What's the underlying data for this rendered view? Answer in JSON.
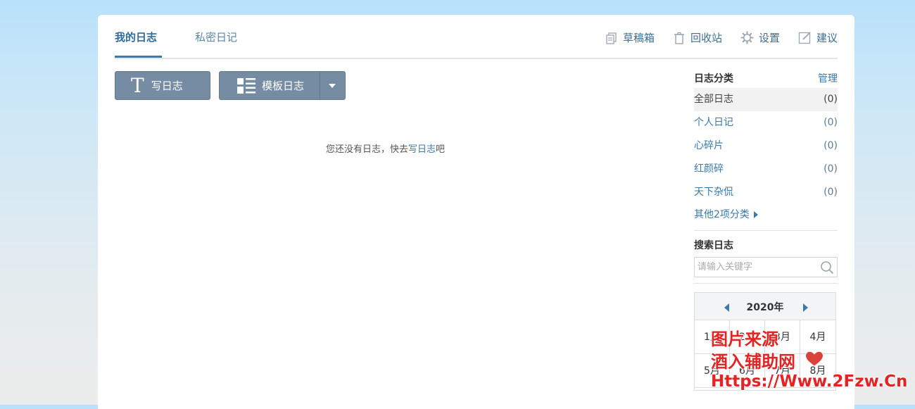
{
  "tabs": [
    {
      "label": "我的日志"
    },
    {
      "label": "私密日记"
    }
  ],
  "toolbar": {
    "drafts_label": "草稿箱",
    "recycle_label": "回收站",
    "settings_label": "设置",
    "feedback_label": "建议"
  },
  "actions": {
    "write_glyph": "T",
    "write_label": "写日志",
    "template_label": "模板日志"
  },
  "empty_state": {
    "prefix": "您还没有日志，快去",
    "link": "写日志",
    "suffix": "吧"
  },
  "sidebar": {
    "categories_title": "日志分类",
    "manage_label": "管理",
    "categories": [
      {
        "name": "全部日志",
        "count": "(0)"
      },
      {
        "name": "个人日记",
        "count": "(0)"
      },
      {
        "name": "心碎片",
        "count": "(0)"
      },
      {
        "name": "红颜碎",
        "count": "(0)"
      },
      {
        "name": "天下杂侃",
        "count": "(0)"
      }
    ],
    "more_label": "其他2项分类",
    "search_title": "搜索日志",
    "search_placeholder": "请输入关键字"
  },
  "calendar": {
    "year": "2020年",
    "months": [
      "1月",
      "2月",
      "3月",
      "4月",
      "5月",
      "6月",
      "7月",
      "8月"
    ]
  },
  "watermark": {
    "line1": "图片来源",
    "line2": "酒入辅助网",
    "line3": "Https://Www.2Fzw.Cn"
  },
  "colors": {
    "accent": "#3a79a8",
    "button": "#768ca2",
    "watermark": "#e22424"
  }
}
